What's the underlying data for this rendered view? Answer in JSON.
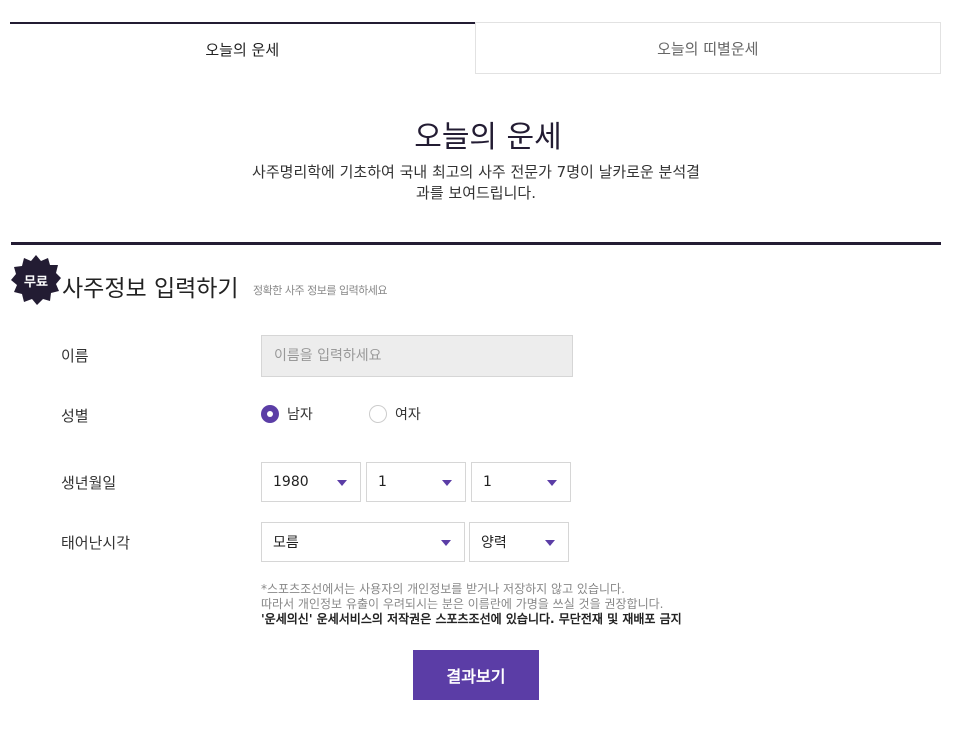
{
  "tabs": [
    {
      "label": "오늘의 운세",
      "active": true
    },
    {
      "label": "오늘의 띠별운세",
      "active": false
    }
  ],
  "header": {
    "title": "오늘의 운세",
    "description_line1": "사주명리학에 기초하여 국내 최고의 사주 전문가 7명이 날카로운 분석결",
    "description_line2": "과를 보여드립니다."
  },
  "section": {
    "badge": "무료",
    "title": "사주정보 입력하기",
    "subtitle": "정확한 사주 정보를 입력하세요"
  },
  "form": {
    "name_label": "이름",
    "name_placeholder": "이름을 입력하세요",
    "name_value": "",
    "gender_label": "성별",
    "gender_options": [
      {
        "label": "남자",
        "selected": true
      },
      {
        "label": "여자",
        "selected": false
      }
    ],
    "birth_label": "생년월일",
    "birth_year": "1980",
    "birth_month": "1",
    "birth_day": "1",
    "time_label": "태어난시각",
    "time_value": "모름",
    "calendar_value": "양력"
  },
  "notice": {
    "line1": "*스포츠조선에서는 사용자의 개인정보를 받거나 저장하지 않고 있습니다.",
    "line2": "따라서 개인정보 유출이 우려되시는 분은 이름란에 가명을 쓰실 것을 권장합니다.",
    "line3": "'운세의신' 운세서비스의 저작권은 스포츠조선에 있습니다. 무단전재 및 재배포 금지"
  },
  "submit_label": "결과보기",
  "colors": {
    "accent": "#5b3da6",
    "dark": "#231c33"
  }
}
